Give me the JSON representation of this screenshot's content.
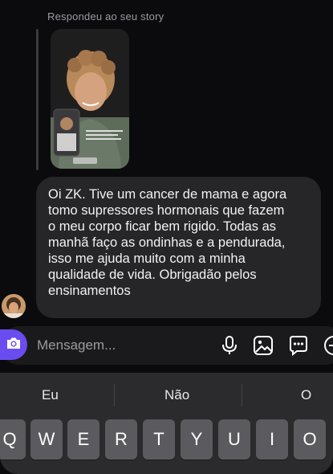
{
  "chat": {
    "reply_label": "Respondeu ao seu story",
    "message": "Oi ZK. Tive um cancer de mama e agora tomo supressores hormonais que fazem o meu corpo ficar bem rigido. Todas as manhã faço as ondinhas e a pendurada, isso me ajuda muito com a minha qualidade de vida. Obrigadão pelos ensinamentos",
    "message_lines": [
      "Oi ZK. Tive um cancer de mama e agora",
      "tomo supressores hormonais que fazem",
      "o meu corpo ficar bem rigido. Todas as",
      "manhã faço as ondinhas e a pendurada,",
      "isso me ajuda muito com a minha",
      "qualidade de vida. Obrigadão pelos",
      "ensinamentos"
    ]
  },
  "input": {
    "placeholder": "Mensagem...",
    "icons": [
      "camera-icon",
      "microphone-icon",
      "gallery-icon",
      "sticker-icon",
      "add-icon"
    ],
    "accent": "#6a4cf0"
  },
  "keyboard": {
    "suggestions": [
      "Eu",
      "Não",
      "O"
    ],
    "row1": [
      "Q",
      "W",
      "E",
      "R",
      "T",
      "Y",
      "U",
      "I",
      "O"
    ]
  }
}
